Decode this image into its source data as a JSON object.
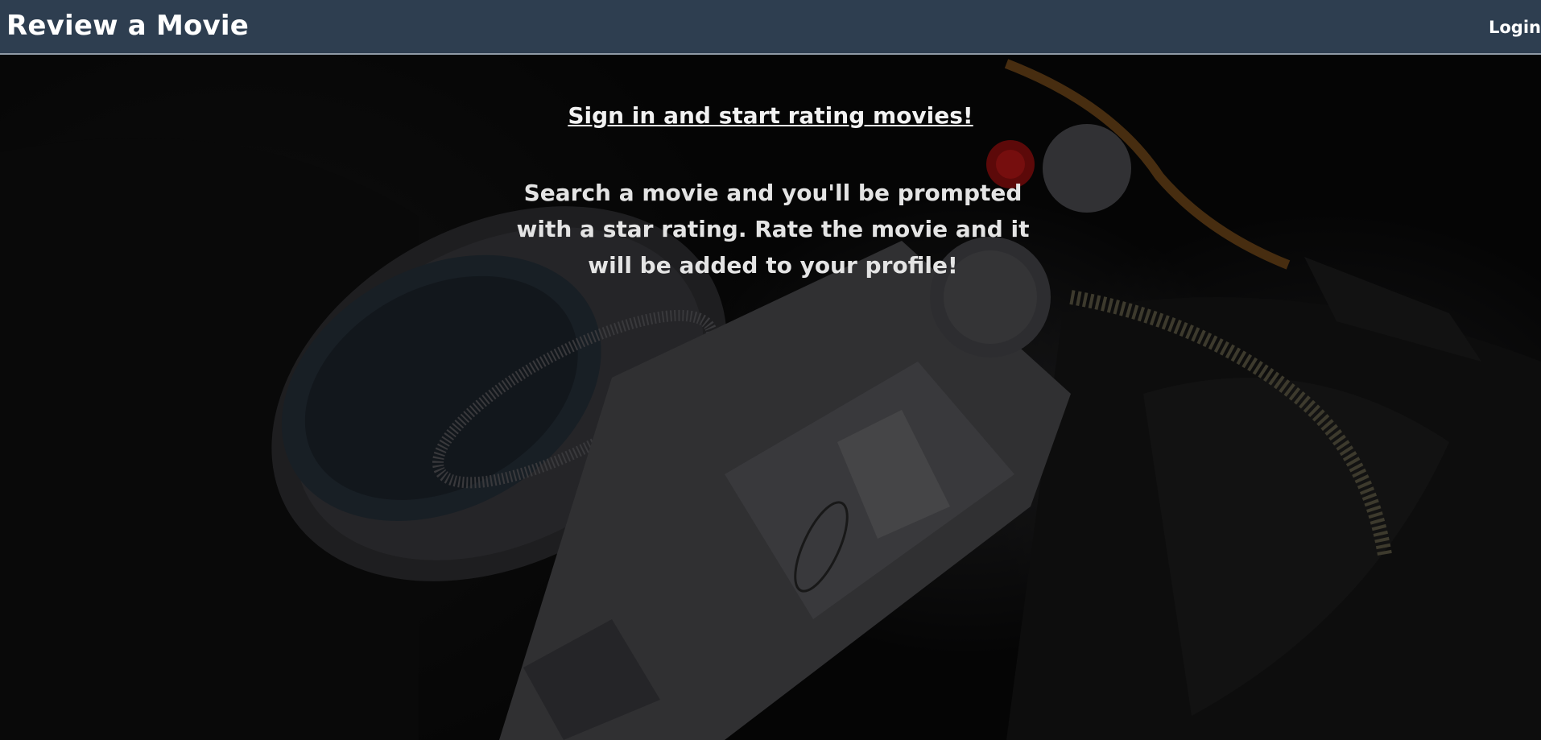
{
  "navbar": {
    "brand": "Review a Movie",
    "login_label": "Login",
    "background_color": "#2e3e50"
  },
  "hero": {
    "headline": "Sign in and start rating movies!",
    "description": "Search a movie and you'll be prompted with a star rating. Rate the movie and it will be added to your profile!",
    "background_image": "camera-photo"
  }
}
